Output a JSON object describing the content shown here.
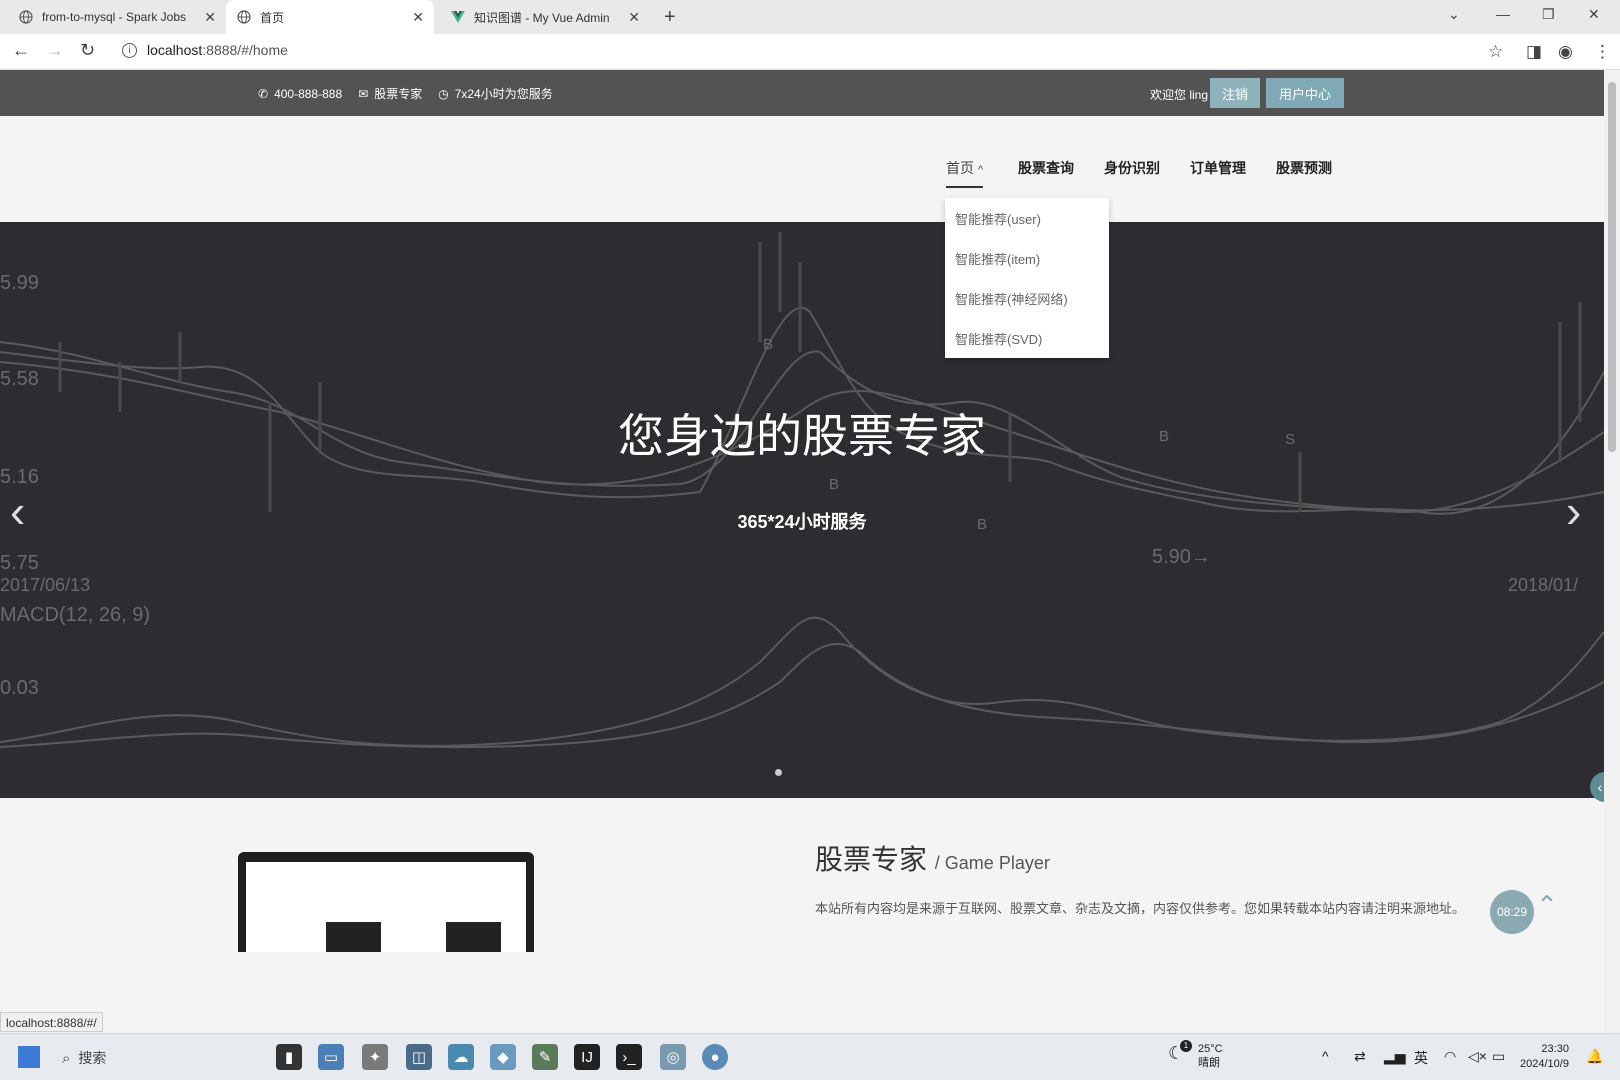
{
  "browser": {
    "tabs": [
      {
        "title": "from-to-mysql - Spark Jobs"
      },
      {
        "title": "首页"
      },
      {
        "title": "知识图谱 - My Vue Admin"
      }
    ],
    "url_host": "localhost",
    "url_rest": ":8888/#/home",
    "status_url": "localhost:8888/#/"
  },
  "topbar": {
    "phone": "400-888-888",
    "email_label": "股票专家",
    "hours": "7x24小时为您服务",
    "welcome": "欢迎您 ling",
    "logout": "注销",
    "user_center": "用户中心"
  },
  "nav": {
    "items": [
      "首页",
      "股票查询",
      "身份识别",
      "订单管理",
      "股票预测"
    ],
    "dropdown": [
      "智能推荐(user)",
      "智能推荐(item)",
      "智能推荐(神经网络)",
      "智能推荐(SVD)"
    ]
  },
  "hero": {
    "title": "您身边的股票专家",
    "subtitle": "365*24小时服务",
    "chart_labels": [
      "5.99",
      "5.58",
      "5.16",
      "5.75",
      "2017/06/13",
      "MACD(12, 26, 9)",
      "0.03",
      "5.90→",
      "2018/01/",
      "B",
      "S"
    ]
  },
  "about": {
    "title": "股票专家",
    "subtitle": "/ Game Player",
    "text": "本站所有内容均是来源于互联网、股票文章、杂志及文摘，内容仅供参考。您如果转载本站内容请注明来源地址。",
    "clock_badge": "08:29"
  },
  "taskbar": {
    "search": "搜索",
    "weather_temp": "25°C",
    "weather_desc": "晴朗",
    "weather_badge": "1",
    "lang": "英",
    "time": "23:30",
    "date": "2024/10/9"
  },
  "colors": {
    "topbar_bg": "#535353",
    "hero_bg": "#2d2c30",
    "accent": "#7fa9b4"
  }
}
